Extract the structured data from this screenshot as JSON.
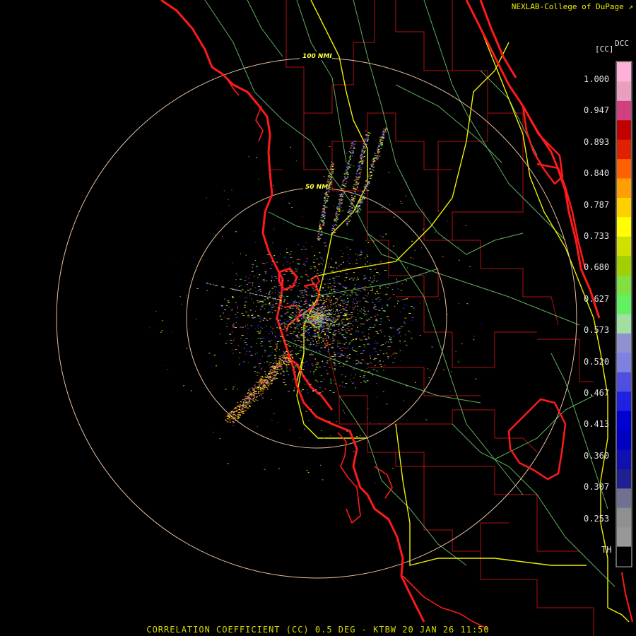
{
  "header": {
    "credit": "NEXLAB-College of DuPage",
    "credit_icon": "external-link-icon"
  },
  "legend": {
    "product_code": "DCC",
    "unit": "[CC]",
    "labels": [
      "1.000",
      "0.947",
      "0.893",
      "0.840",
      "0.787",
      "0.733",
      "0.680",
      "0.627",
      "0.573",
      "0.520",
      "0.467",
      "0.413",
      "0.360",
      "0.307",
      "0.253",
      "TH"
    ],
    "color_bands": [
      {
        "color": "#ffb0d8"
      },
      {
        "color": "#e8a0c0"
      },
      {
        "color": "#d04080"
      },
      {
        "color": "#c00000"
      },
      {
        "color": "#e02000"
      },
      {
        "color": "#ff6000"
      },
      {
        "color": "#ffa000"
      },
      {
        "color": "#ffd000"
      },
      {
        "color": "#ffff00"
      },
      {
        "color": "#d0e000"
      },
      {
        "color": "#a0d000"
      },
      {
        "color": "#80e040"
      },
      {
        "color": "#60f060"
      },
      {
        "color": "#a0e0a0"
      },
      {
        "color": "#9090d0"
      },
      {
        "color": "#8080e0"
      },
      {
        "color": "#5050e0"
      },
      {
        "color": "#2020e0"
      },
      {
        "color": "#0000d0"
      },
      {
        "color": "#0000c0"
      },
      {
        "color": "#1010b0"
      },
      {
        "color": "#202090"
      },
      {
        "color": "#707090"
      },
      {
        "color": "#909090"
      },
      {
        "color": "#989898"
      },
      {
        "color": "#000000"
      }
    ]
  },
  "range_rings": [
    {
      "label": "100 NMI"
    },
    {
      "label": "50 NMI"
    }
  ],
  "colors": {
    "coastline": "#ff1a1a",
    "county": "#b01010",
    "highway": "#f0f000",
    "road": "#70d070",
    "ring": "#e8c0a0"
  },
  "footer": {
    "caption": "CORRELATION COEFFICIENT (CC) 0.5 DEG - KTBW 20 JAN 26 11:50"
  }
}
